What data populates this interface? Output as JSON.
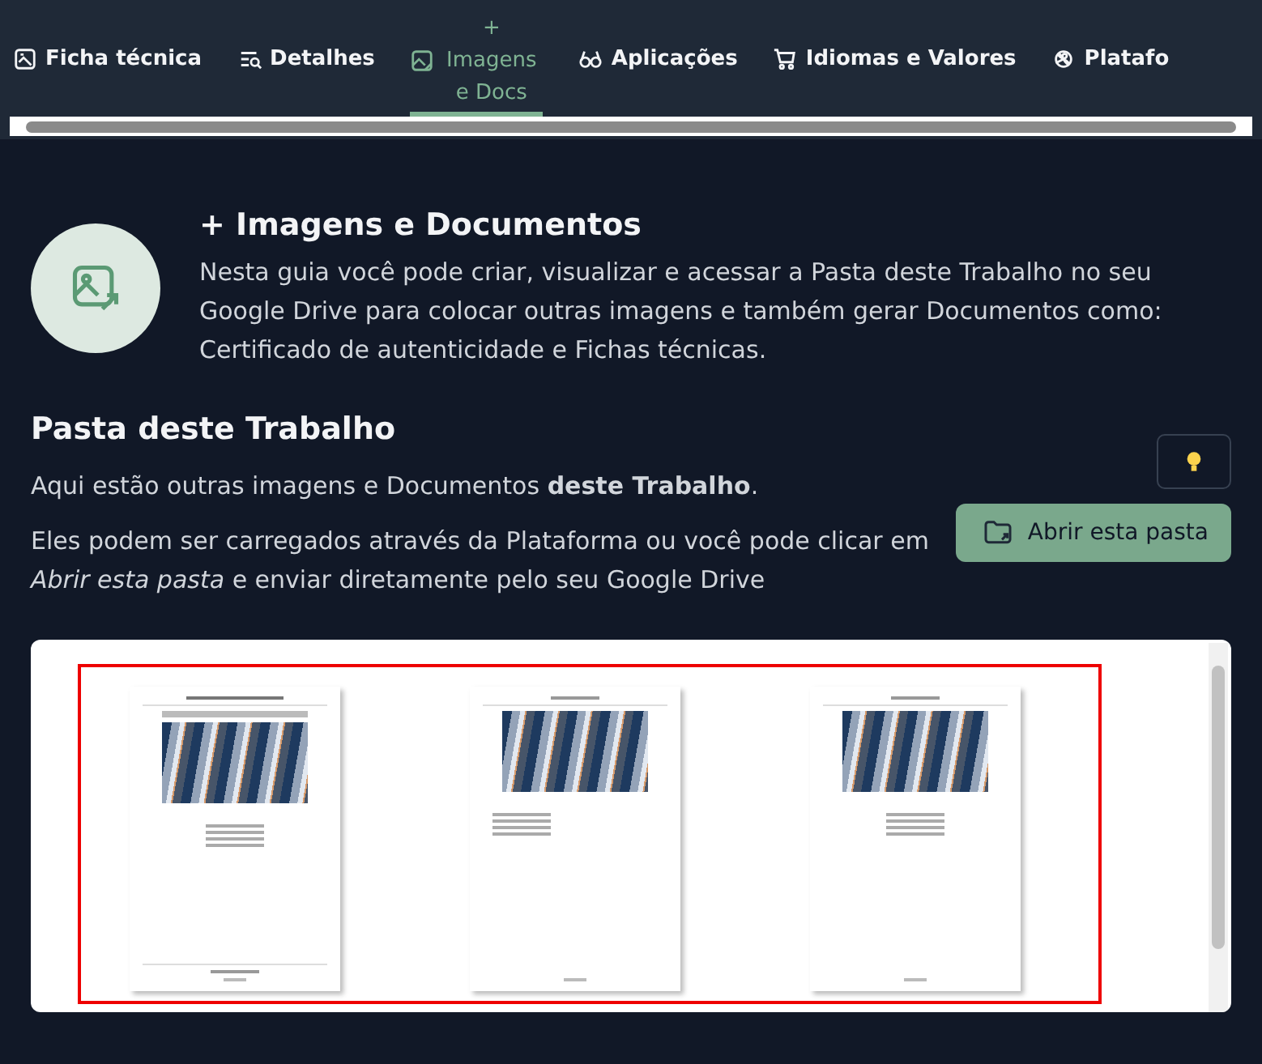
{
  "tabs": [
    {
      "label": "Ficha técnica",
      "selected": false
    },
    {
      "label": "Detalhes",
      "selected": false
    },
    {
      "label": "+ Imagens e Docs",
      "selected": true
    },
    {
      "label": "Aplicações",
      "selected": false
    },
    {
      "label": "Idiomas e Valores",
      "selected": false
    },
    {
      "label": "Platafo",
      "selected": false
    }
  ],
  "intro": {
    "title": "+ Imagens e Documentos",
    "text": "Nesta guia você pode criar, visualizar e acessar a Pasta deste Trabalho no seu Google Drive para colocar outras imagens e também gerar Documentos como: Certificado de autenticidade e Fichas técnicas."
  },
  "folder": {
    "title": "Pasta deste Trabalho",
    "line_1": "Aqui estão outras imagens e Documentos **deste Trabalho**.",
    "line_2": "Eles podem ser carregados através da Plataforma ou você pode clicar em *Abrir esta pasta* e enviar diretamente pelo seu Google Drive",
    "open_button": "Abrir esta pasta"
  },
  "documents": [
    {
      "kind": "certificate"
    },
    {
      "kind": "sheet"
    },
    {
      "kind": "sheet_centered"
    }
  ]
}
